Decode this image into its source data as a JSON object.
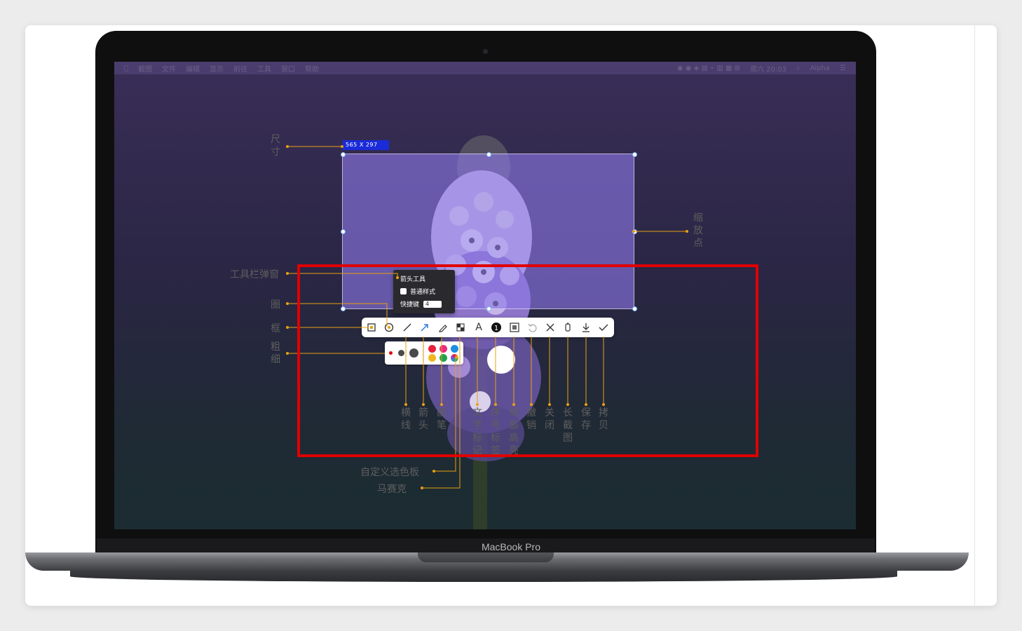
{
  "device": {
    "brand": "MacBook Pro"
  },
  "menubar": {
    "items": [
      "截图",
      "文件",
      "编辑",
      "显示",
      "前往",
      "工具",
      "窗口",
      "帮助"
    ],
    "status": [
      "周六 20:03",
      "Alpha"
    ]
  },
  "selection": {
    "size_text": "565  X  297"
  },
  "popup": {
    "title": "箭头工具",
    "option": "普通样式",
    "shortcut_label": "快捷键",
    "shortcut_value": "4"
  },
  "labels": {
    "size": "尺寸",
    "zoom_point": "缩放点",
    "toolbar_popup": "工具栏弹窗",
    "circle": "圈",
    "frame": "框",
    "thickness": "粗细",
    "line": "横线",
    "arrow": "箭头",
    "pen": "画笔",
    "text": "文字标记",
    "number": "序号标签",
    "highlight": "局部高亮",
    "undo": "撤销",
    "close": "关闭",
    "long_shot": "长截图",
    "save": "保存",
    "copy": "拷贝",
    "custom_palette": "自定义选色板",
    "mosaic": "马赛克"
  },
  "palette": {
    "colors": [
      "#e8203b",
      "#ea2a7e",
      "#1d8fe0",
      "#f2b61d",
      "#1ea24a"
    ],
    "highlight_color": "#e00000",
    "leader_color": "#e8a10f"
  }
}
